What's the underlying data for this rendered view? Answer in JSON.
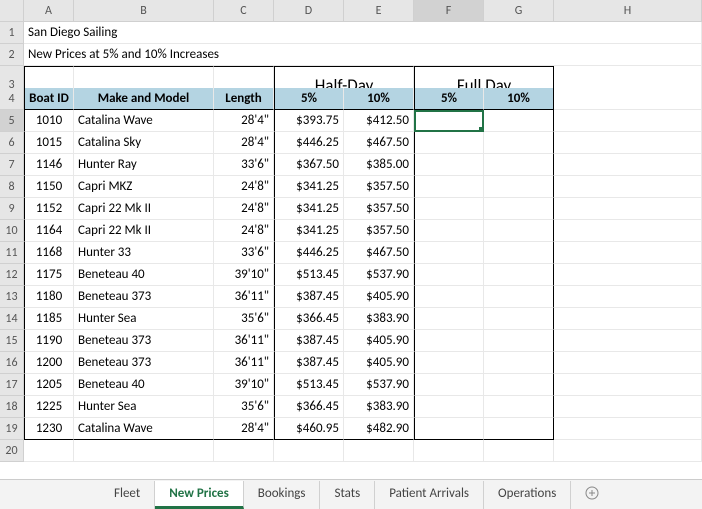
{
  "columns": [
    "A",
    "B",
    "C",
    "D",
    "E",
    "F",
    "G",
    "H"
  ],
  "title_rows": {
    "r1": "San Diego Sailing",
    "r2": "New Prices at 5% and 10% Increases"
  },
  "group_headers": {
    "half_day": "Half-Day",
    "full_day": "Full Day"
  },
  "table_headers": {
    "boat_id": "Boat ID",
    "make_model": "Make and Model",
    "length": "Length",
    "five_pct": "5%",
    "ten_pct": "10%"
  },
  "rows": [
    {
      "n": 5,
      "id": "1010",
      "model": "Catalina Wave",
      "len": "28'4\"",
      "h5": "$393.75",
      "h10": "$412.50"
    },
    {
      "n": 6,
      "id": "1015",
      "model": "Catalina Sky",
      "len": "28'4\"",
      "h5": "$446.25",
      "h10": "$467.50"
    },
    {
      "n": 7,
      "id": "1146",
      "model": "Hunter Ray",
      "len": "33'6\"",
      "h5": "$367.50",
      "h10": "$385.00"
    },
    {
      "n": 8,
      "id": "1150",
      "model": "Capri MKZ",
      "len": "24'8\"",
      "h5": "$341.25",
      "h10": "$357.50"
    },
    {
      "n": 9,
      "id": "1152",
      "model": "Capri 22 Mk II",
      "len": "24'8\"",
      "h5": "$341.25",
      "h10": "$357.50"
    },
    {
      "n": 10,
      "id": "1164",
      "model": "Capri 22 Mk II",
      "len": "24'8\"",
      "h5": "$341.25",
      "h10": "$357.50"
    },
    {
      "n": 11,
      "id": "1168",
      "model": "Hunter 33",
      "len": "33'6\"",
      "h5": "$446.25",
      "h10": "$467.50"
    },
    {
      "n": 12,
      "id": "1175",
      "model": "Beneteau 40",
      "len": "39'10\"",
      "h5": "$513.45",
      "h10": "$537.90"
    },
    {
      "n": 13,
      "id": "1180",
      "model": "Beneteau 373",
      "len": "36'11\"",
      "h5": "$387.45",
      "h10": "$405.90"
    },
    {
      "n": 14,
      "id": "1185",
      "model": "Hunter Sea",
      "len": "35'6\"",
      "h5": "$366.45",
      "h10": "$383.90"
    },
    {
      "n": 15,
      "id": "1190",
      "model": "Beneteau 373",
      "len": "36'11\"",
      "h5": "$387.45",
      "h10": "$405.90"
    },
    {
      "n": 16,
      "id": "1200",
      "model": "Beneteau 373",
      "len": "36'11\"",
      "h5": "$387.45",
      "h10": "$405.90"
    },
    {
      "n": 17,
      "id": "1205",
      "model": "Beneteau 40",
      "len": "39'10\"",
      "h5": "$513.45",
      "h10": "$537.90"
    },
    {
      "n": 18,
      "id": "1225",
      "model": "Hunter Sea",
      "len": "35'6\"",
      "h5": "$366.45",
      "h10": "$383.90"
    },
    {
      "n": 19,
      "id": "1230",
      "model": "Catalina Wave",
      "len": "28'4\"",
      "h5": "$460.95",
      "h10": "$482.90"
    }
  ],
  "tabs": [
    "Fleet",
    "New Prices",
    "Bookings",
    "Stats",
    "Patient Arrivals",
    "Operations"
  ],
  "active_tab": 1,
  "active_cell": "F5",
  "chart_data": {
    "type": "table",
    "title": "San Diego Sailing — New Prices at 5% and 10% Increases",
    "columns": [
      "Boat ID",
      "Make and Model",
      "Length",
      "Half-Day 5%",
      "Half-Day 10%",
      "Full Day 5%",
      "Full Day 10%"
    ],
    "rows": [
      [
        "1010",
        "Catalina Wave",
        "28'4\"",
        393.75,
        412.5,
        null,
        null
      ],
      [
        "1015",
        "Catalina Sky",
        "28'4\"",
        446.25,
        467.5,
        null,
        null
      ],
      [
        "1146",
        "Hunter Ray",
        "33'6\"",
        367.5,
        385.0,
        null,
        null
      ],
      [
        "1150",
        "Capri MKZ",
        "24'8\"",
        341.25,
        357.5,
        null,
        null
      ],
      [
        "1152",
        "Capri 22 Mk II",
        "24'8\"",
        341.25,
        357.5,
        null,
        null
      ],
      [
        "1164",
        "Capri 22 Mk II",
        "24'8\"",
        341.25,
        357.5,
        null,
        null
      ],
      [
        "1168",
        "Hunter 33",
        "33'6\"",
        446.25,
        467.5,
        null,
        null
      ],
      [
        "1175",
        "Beneteau 40",
        "39'10\"",
        513.45,
        537.9,
        null,
        null
      ],
      [
        "1180",
        "Beneteau 373",
        "36'11\"",
        387.45,
        405.9,
        null,
        null
      ],
      [
        "1185",
        "Hunter Sea",
        "35'6\"",
        366.45,
        383.9,
        null,
        null
      ],
      [
        "1190",
        "Beneteau 373",
        "36'11\"",
        387.45,
        405.9,
        null,
        null
      ],
      [
        "1200",
        "Beneteau 373",
        "36'11\"",
        387.45,
        405.9,
        null,
        null
      ],
      [
        "1205",
        "Beneteau 40",
        "39'10\"",
        513.45,
        537.9,
        null,
        null
      ],
      [
        "1225",
        "Hunter Sea",
        "35'6\"",
        366.45,
        383.9,
        null,
        null
      ],
      [
        "1230",
        "Catalina Wave",
        "28'4\"",
        460.95,
        482.9,
        null,
        null
      ]
    ]
  }
}
